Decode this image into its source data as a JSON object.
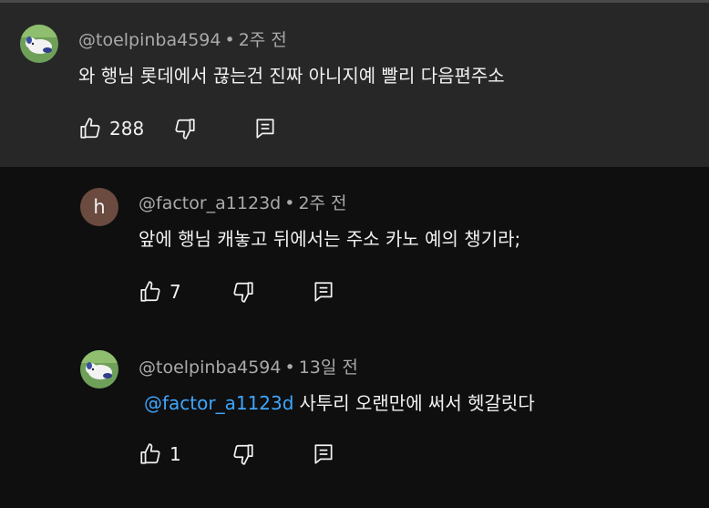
{
  "comments": [
    {
      "author": "@toelpinba4594",
      "time": "2주 전",
      "text": "와 행님 롯데에서 끊는건 진짜 아니지예 빨리 다음편주소",
      "likes": "288",
      "avatar_icon": "puppy-avatar-icon"
    },
    {
      "author": "@factor_a1123d",
      "time": "2주 전",
      "text": "앞에 행님 캐놓고 뒤에서는 주소 카노 예의 챙기라;",
      "likes": "7",
      "avatar_letter": "h",
      "avatar_color": "#6b4a40"
    },
    {
      "author": "@toelpinba4594",
      "time": "13일 전",
      "mention": "@factor_a1123d",
      "text": "사투리 오랜만에 써서 헷갈릿다",
      "likes": "1",
      "avatar_icon": "puppy-avatar-icon"
    }
  ],
  "separator": "•",
  "colors": {
    "highlight_bg": "#272727",
    "page_bg": "#0f0f0f",
    "mention": "#3ea6ff",
    "meta": "#aaaaaa"
  }
}
